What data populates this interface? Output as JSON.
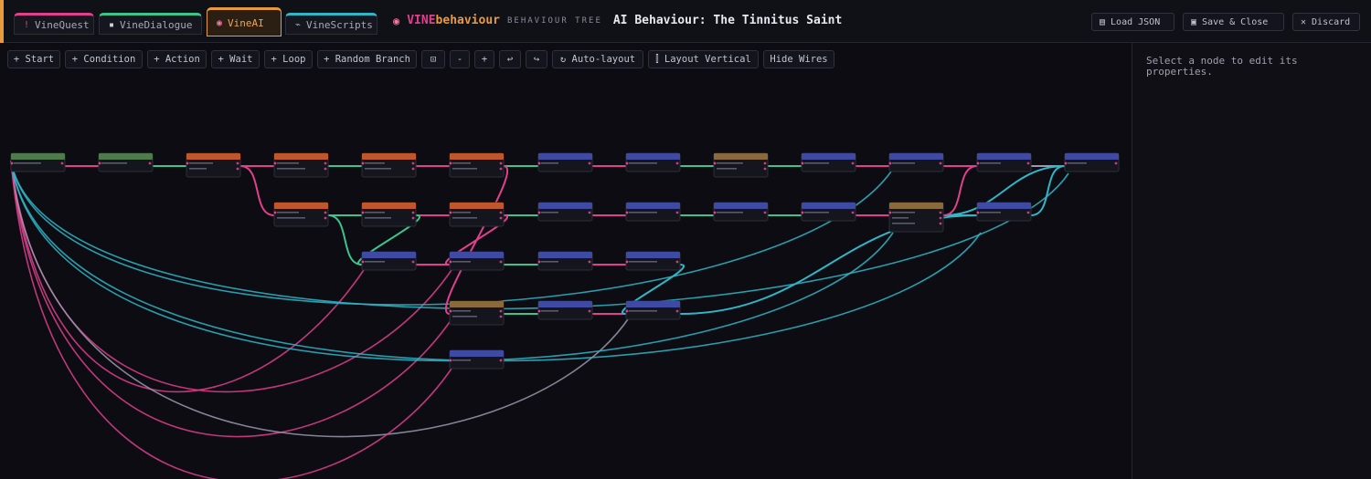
{
  "tabs": [
    {
      "label": "VineQuest",
      "icon": "!",
      "color": "#e0408e"
    },
    {
      "label": "VineDialogue",
      "icon": "▪",
      "color": "#3cc48c"
    },
    {
      "label": "VineAI",
      "icon": "◉",
      "color": "#e89a3c"
    },
    {
      "label": "VineScripts",
      "icon": "⌁",
      "color": "#2fb7c9"
    }
  ],
  "brand": {
    "part1": "VINE",
    "part2": "behaviour",
    "subtitle": "BEHAVIOUR TREE",
    "title": "AI Behaviour: The Tinnitus Saint"
  },
  "header_buttons": {
    "load": "Load JSON",
    "save": "Save & Close",
    "discard": "Discard"
  },
  "toolbar": {
    "start": "+ Start",
    "condition": "+ Condition",
    "action": "+ Action",
    "wait": "+ Wait",
    "loop": "+ Loop",
    "random": "+ Random Branch",
    "fit": "⊡",
    "zoom_out": "-",
    "zoom_in": "+",
    "undo": "↩",
    "redo": "↪",
    "autolayout": "↻ Auto-layout",
    "layout_vertical": "⫿ Layout Vertical",
    "hide_wires": "Hide Wires"
  },
  "panel": {
    "hint": "Select a node to edit its properties."
  },
  "colors": {
    "start": "#4e7a4c",
    "condition": "#c0562c",
    "action": "#3f4aa5",
    "random": "#8a6a3c",
    "wire_pink": "#e0408e",
    "wire_green": "#3cc48c",
    "wire_cyan": "#2fb7c9",
    "wire_grey": "#9a9aae"
  }
}
